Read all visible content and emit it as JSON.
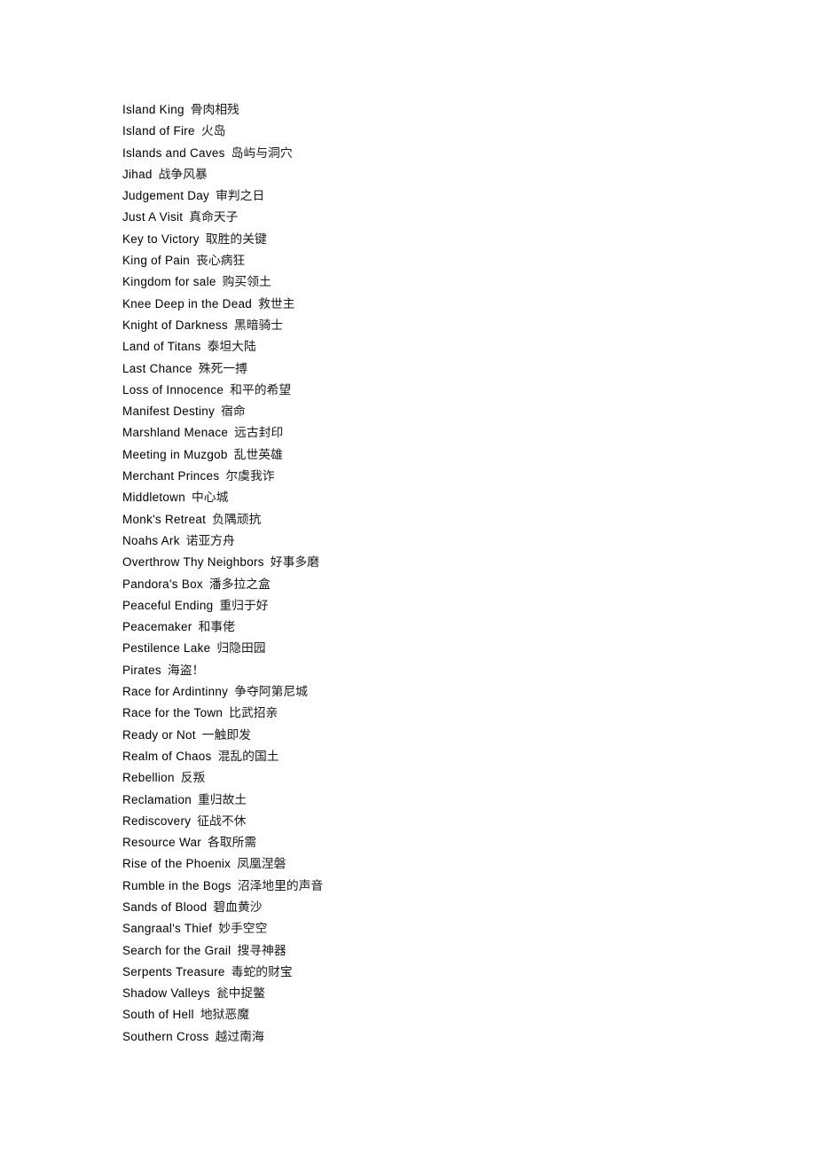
{
  "document": {
    "type": "scenario-name-list",
    "text_color": "#000000",
    "background_color": "#ffffff",
    "entries": [
      {
        "en": "Island King",
        "zh": "骨肉相残"
      },
      {
        "en": "Island of Fire",
        "zh": "火岛"
      },
      {
        "en": "Islands and Caves",
        "zh": "岛屿与洞穴"
      },
      {
        "en": "Jihad",
        "zh": "战争风暴"
      },
      {
        "en": "Judgement Day",
        "zh": "审判之日"
      },
      {
        "en": "Just A Visit",
        "zh": "真命天子"
      },
      {
        "en": "Key to Victory",
        "zh": "取胜的关键"
      },
      {
        "en": "King of Pain",
        "zh": "丧心病狂"
      },
      {
        "en": "Kingdom for sale",
        "zh": "购买领土"
      },
      {
        "en": "Knee Deep in the Dead",
        "zh": "救世主"
      },
      {
        "en": "Knight of Darkness",
        "zh": "黑暗骑士"
      },
      {
        "en": "Land of Titans",
        "zh": "泰坦大陆"
      },
      {
        "en": "Last Chance",
        "zh": "殊死一搏"
      },
      {
        "en": "Loss of Innocence",
        "zh": "和平的希望"
      },
      {
        "en": "Manifest Destiny",
        "zh": "宿命"
      },
      {
        "en": "Marshland Menace",
        "zh": "远古封印"
      },
      {
        "en": "Meeting in Muzgob",
        "zh": "乱世英雄"
      },
      {
        "en": "Merchant Princes",
        "zh": "尔虞我诈"
      },
      {
        "en": "Middletown",
        "zh": "中心城"
      },
      {
        "en": "Monk's Retreat",
        "zh": "负隅顽抗"
      },
      {
        "en": "Noahs Ark",
        "zh": "诺亚方舟"
      },
      {
        "en": "Overthrow Thy Neighbors",
        "zh": "好事多磨"
      },
      {
        "en": "Pandora's Box",
        "zh": "潘多拉之盒"
      },
      {
        "en": "Peaceful Ending",
        "zh": "重归于好"
      },
      {
        "en": "Peacemaker",
        "zh": "和事佬"
      },
      {
        "en": "Pestilence Lake",
        "zh": "归隐田园"
      },
      {
        "en": "Pirates",
        "zh": "海盗！"
      },
      {
        "en": "Race for Ardintinny",
        "zh": "争夺阿第尼城"
      },
      {
        "en": "Race for the Town",
        "zh": "比武招亲"
      },
      {
        "en": "Ready or Not",
        "zh": "一触即发"
      },
      {
        "en": "Realm of Chaos",
        "zh": "混乱的国土"
      },
      {
        "en": "Rebellion",
        "zh": "反叛"
      },
      {
        "en": "Reclamation",
        "zh": "重归故土"
      },
      {
        "en": "Rediscovery",
        "zh": "征战不休"
      },
      {
        "en": "Resource War",
        "zh": "各取所需"
      },
      {
        "en": "Rise of the Phoenix",
        "zh": "凤凰涅磐"
      },
      {
        "en": "Rumble in the Bogs",
        "zh": "沼泽地里的声音"
      },
      {
        "en": "Sands of Blood",
        "zh": "碧血黄沙"
      },
      {
        "en": "Sangraal's Thief",
        "zh": "妙手空空"
      },
      {
        "en": "Search for the Grail",
        "zh": "搜寻神器"
      },
      {
        "en": "Serpents Treasure",
        "zh": "毒蛇的财宝"
      },
      {
        "en": "Shadow Valleys",
        "zh": "瓮中捉鳖"
      },
      {
        "en": "South of Hell",
        "zh": "地狱恶魔"
      },
      {
        "en": "Southern Cross",
        "zh": "越过南海"
      }
    ]
  }
}
